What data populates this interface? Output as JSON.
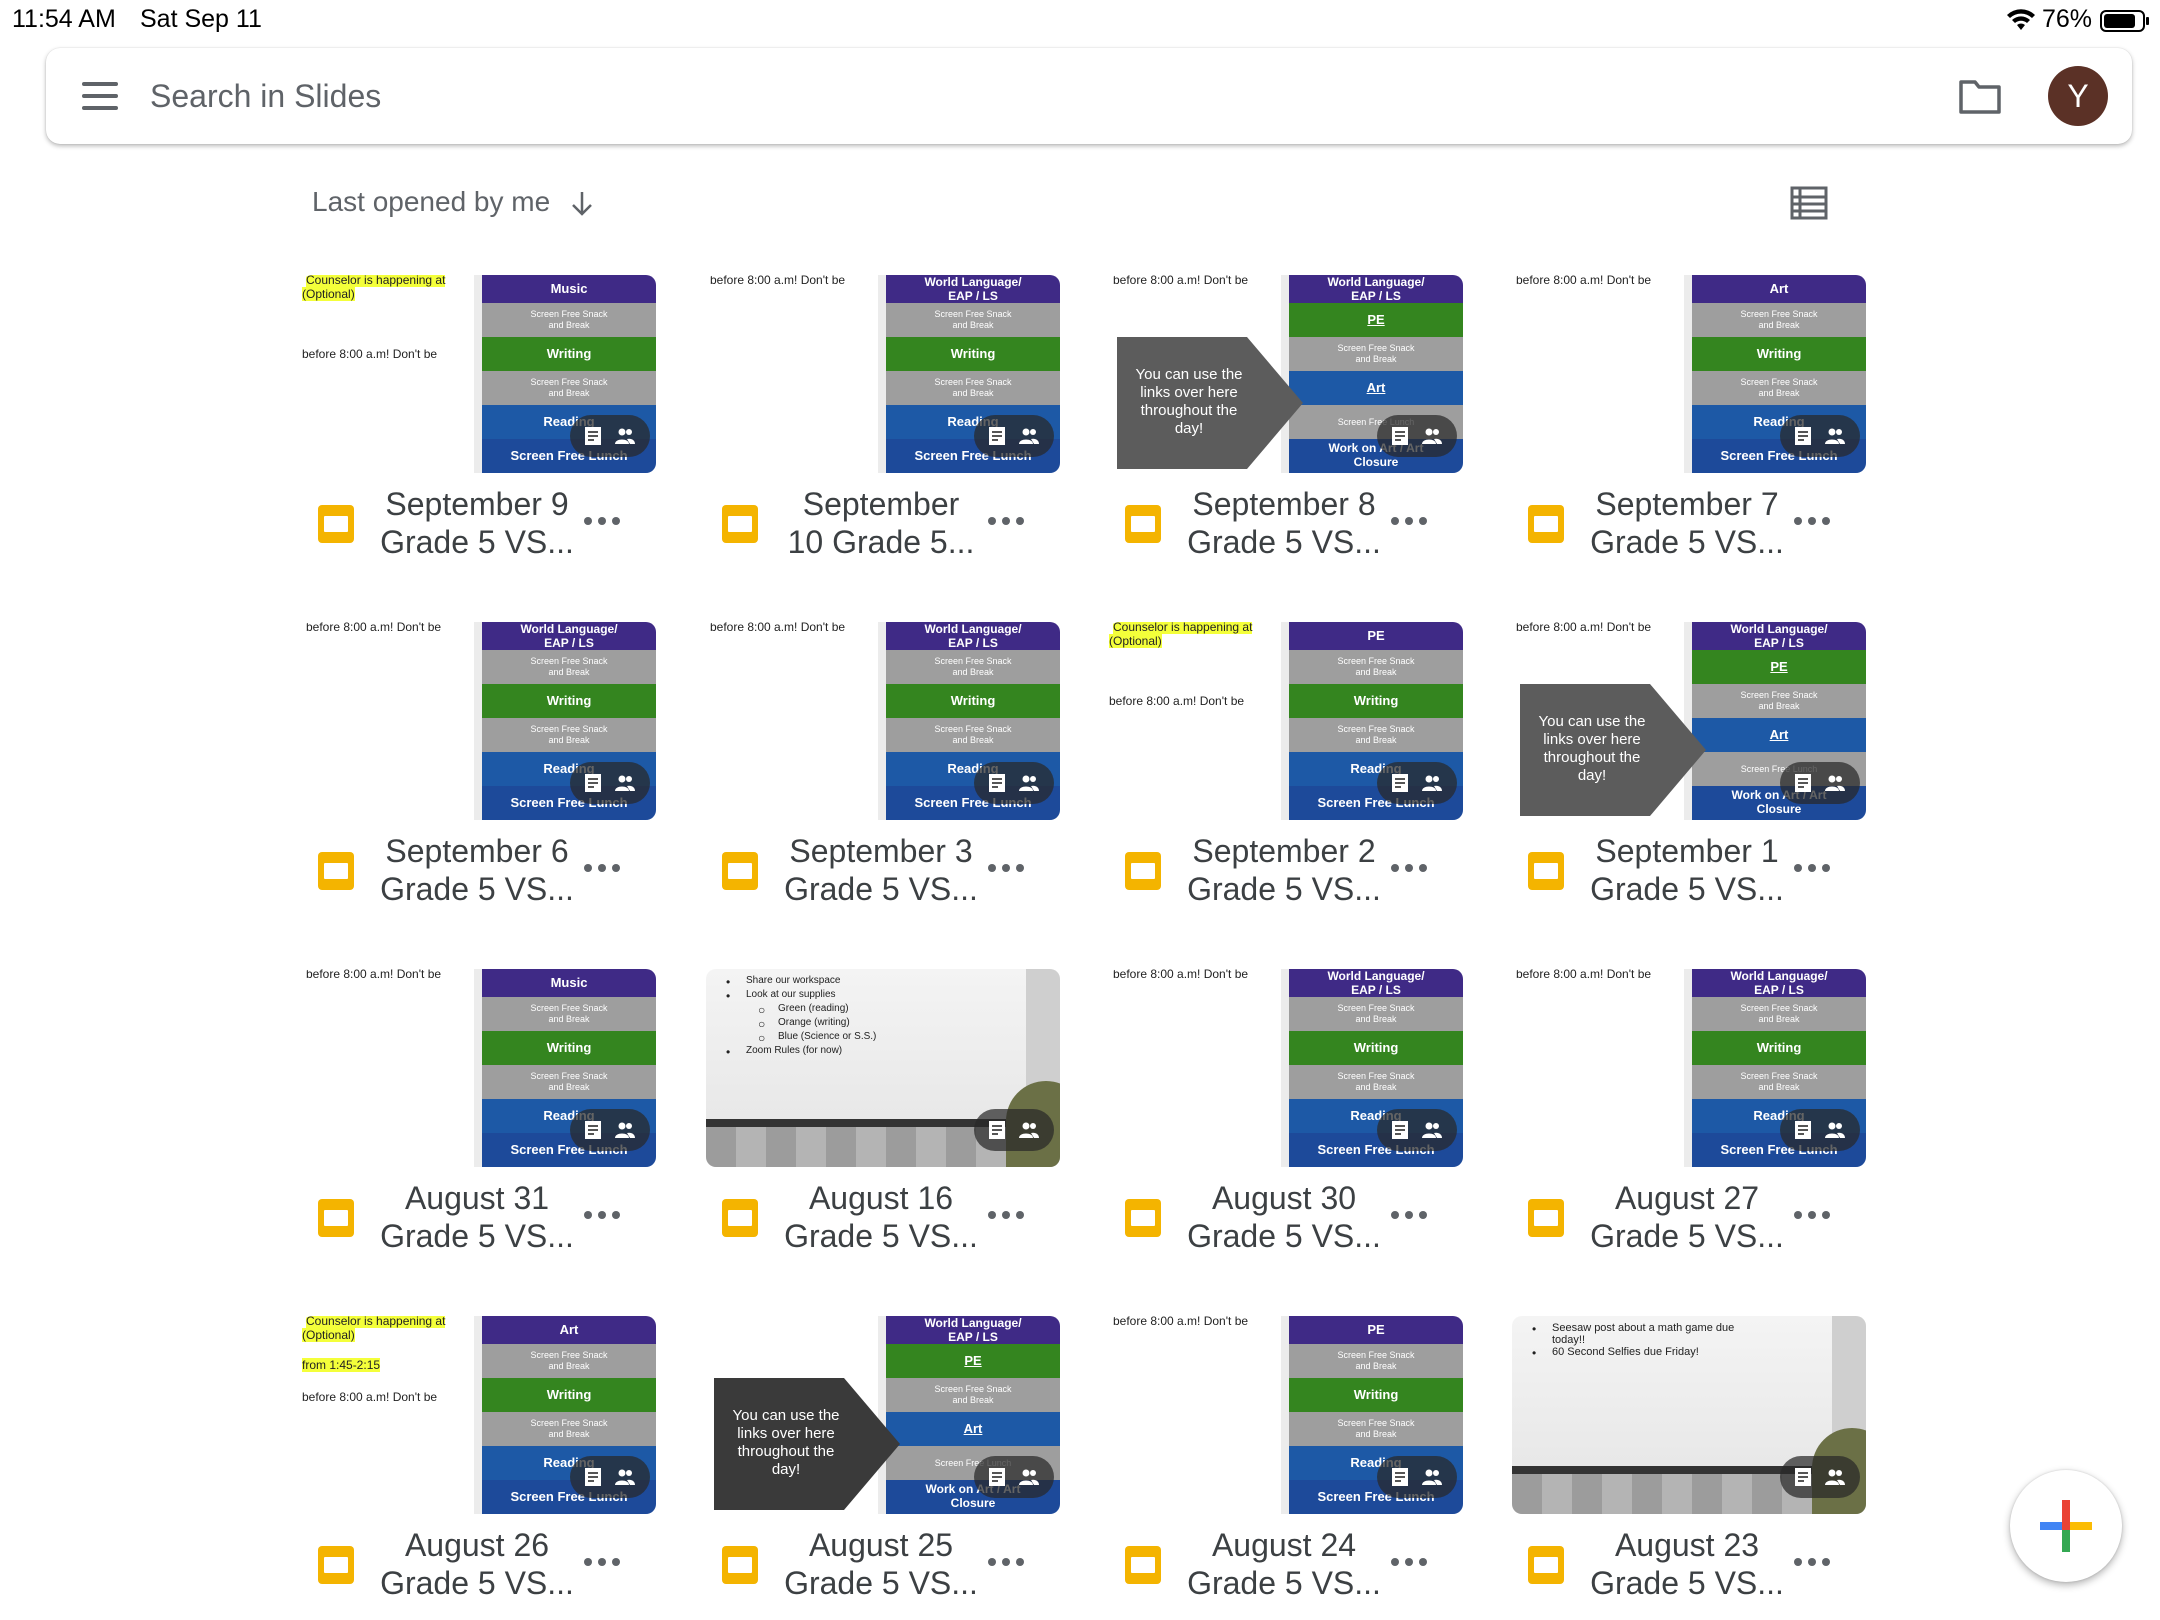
{
  "status": {
    "time": "11:54 AM",
    "date": "Sat Sep 11",
    "battery": "76%"
  },
  "search": {
    "placeholder": "Search in Slides",
    "avatar_letter": "Y"
  },
  "sort": {
    "label": "Last opened by me"
  },
  "snippets": {
    "counselor": "Counselor is happening at",
    "optional": "(Optional)",
    "before": "before 8:00 a.m! Don't be",
    "time_145": "from 1:45-2:15",
    "links": [
      "You can use the",
      "links over here",
      "throughout the",
      "day!"
    ],
    "wb1": [
      "Share our workspace",
      "Look at our supplies",
      "Green (reading)",
      "Orange (writing)",
      "Blue (Science or S.S.)",
      "Zoom Rules (for now)"
    ],
    "wb2": [
      "Seesaw post about a math game due",
      "today!!",
      "60 Second Selfies due Friday!"
    ],
    "sched": {
      "music": "Music",
      "art": "Art",
      "pe": "PE",
      "wl": "World Language/",
      "eap": "EAP / LS",
      "snack": "Screen Free Snack",
      "and_break": "and Break",
      "writing": "Writing",
      "reading": "Reading",
      "lunch": "Screen Free Lunch",
      "work_art": "Work on Art / Art",
      "closure": "Closure"
    }
  },
  "files": [
    {
      "title_l1": "September 9",
      "title_l2": "Grade 5 VS...",
      "thumb": "schedule",
      "header": "Music",
      "notes": "counselor"
    },
    {
      "title_l1": "September",
      "title_l2": "10 Grade 5...",
      "thumb": "schedule",
      "header": "World Language/ EAP / LS",
      "notes": "before"
    },
    {
      "title_l1": "September 8",
      "title_l2": "Grade 5 VS...",
      "thumb": "arrow",
      "header": "World Language / EAP / LS",
      "notes": "before"
    },
    {
      "title_l1": "September 7",
      "title_l2": "Grade 5 VS...",
      "thumb": "schedule",
      "header": "Art",
      "notes": "before"
    },
    {
      "title_l1": "September 6",
      "title_l2": "Grade 5 VS...",
      "thumb": "schedule",
      "header": "World Language/ EAP / LS",
      "notes": "before"
    },
    {
      "title_l1": "September 3",
      "title_l2": "Grade 5 VS...",
      "thumb": "schedule",
      "header": "World Language/ EAP / LS",
      "notes": "before"
    },
    {
      "title_l1": "September 2",
      "title_l2": "Grade 5 VS...",
      "thumb": "schedule",
      "header": "PE",
      "notes": "counselor"
    },
    {
      "title_l1": "September 1",
      "title_l2": "Grade 5 VS...",
      "thumb": "arrow",
      "header": "World Language / EAP / LS",
      "notes": "before"
    },
    {
      "title_l1": "August 31",
      "title_l2": "Grade 5 VS...",
      "thumb": "schedule",
      "header": "Music",
      "notes": "before"
    },
    {
      "title_l1": "August 16",
      "title_l2": "Grade 5 VS...",
      "thumb": "whiteboard",
      "notes": "wb1"
    },
    {
      "title_l1": "August 30",
      "title_l2": "Grade 5 VS...",
      "thumb": "schedule",
      "header": "World Language/ EAP / LS",
      "notes": "before"
    },
    {
      "title_l1": "August 27",
      "title_l2": "Grade 5 VS...",
      "thumb": "schedule",
      "header": "World Language/ EAP / LS",
      "notes": "before"
    },
    {
      "title_l1": "August 26",
      "title_l2": "Grade 5 VS...",
      "thumb": "schedule",
      "header": "Art",
      "notes": "counselor2"
    },
    {
      "title_l1": "August 25",
      "title_l2": "Grade 5 VS...",
      "thumb": "arrow",
      "header": "World Language / EAP / LS",
      "notes": "none"
    },
    {
      "title_l1": "August 24",
      "title_l2": "Grade 5 VS...",
      "thumb": "schedule",
      "header": "PE",
      "notes": "before"
    },
    {
      "title_l1": "August 23",
      "title_l2": "Grade 5 VS...",
      "thumb": "whiteboard",
      "notes": "wb2"
    }
  ],
  "colors": {
    "slides_yellow": "#f4b400",
    "avatar_bg": "#5b3126",
    "accent_gray": "#5f6368"
  }
}
